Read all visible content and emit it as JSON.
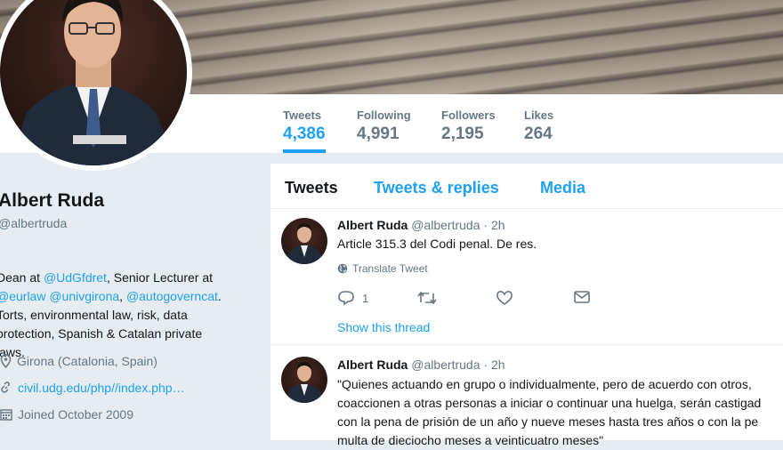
{
  "profile": {
    "name": "Albert Ruda",
    "handle": "@albertruda",
    "bio_lines": [
      {
        "parts": [
          {
            "t": "Dean at ",
            "link": false
          },
          {
            "t": "@UdGfdret",
            "link": true
          },
          {
            "t": ", Senior Lecturer at",
            "link": false
          }
        ]
      },
      {
        "parts": [
          {
            "t": "@eurlaw",
            "link": true
          },
          {
            "t": " ",
            "link": false
          },
          {
            "t": "@univgirona",
            "link": true
          },
          {
            "t": ", ",
            "link": false
          },
          {
            "t": "@autogoverncat",
            "link": true
          },
          {
            "t": ".",
            "link": false
          }
        ]
      },
      {
        "parts": [
          {
            "t": "Torts, environmental law, risk, data",
            "link": false
          }
        ]
      },
      {
        "parts": [
          {
            "t": "protection, Spanish & Catalan private",
            "link": false
          }
        ]
      },
      {
        "parts": [
          {
            "t": "laws.",
            "link": false
          }
        ]
      }
    ],
    "location": "Girona (Catalonia, Spain)",
    "website": "civil.udg.edu/php//index.php…",
    "joined": "Joined October 2009"
  },
  "stats": [
    {
      "label": "Tweets",
      "value": "4,386",
      "active": true
    },
    {
      "label": "Following",
      "value": "4,991",
      "active": false
    },
    {
      "label": "Followers",
      "value": "2,195",
      "active": false
    },
    {
      "label": "Likes",
      "value": "264",
      "active": false
    }
  ],
  "tabs": [
    {
      "label": "Tweets",
      "active": true
    },
    {
      "label": "Tweets & replies",
      "active": false
    },
    {
      "label": "Media",
      "active": false
    }
  ],
  "tweets": [
    {
      "name": "Albert Ruda",
      "handle": "@albertruda",
      "time": "· 2h",
      "text_lines": [
        "Article 315.3 del Codi penal. De res."
      ],
      "translate": "Translate Tweet",
      "reply_count": "1",
      "show_thread": "Show this thread"
    },
    {
      "name": "Albert Ruda",
      "handle": "@albertruda",
      "time": "· 2h",
      "text_lines": [
        "\"Quienes actuando en grupo o individualmente, pero de acuerdo con otros,",
        "coaccionen a otras personas a iniciar o continuar una huelga, serán castigad",
        "con la pena de prisión de un año y nueve meses hasta tres años o con la pe",
        "multa de dieciocho meses a veinticuatro meses\""
      ]
    }
  ],
  "colors": {
    "accent": "#1da1f2",
    "muted": "#657786",
    "text": "#14171a",
    "bg": "#e6ecf0"
  }
}
